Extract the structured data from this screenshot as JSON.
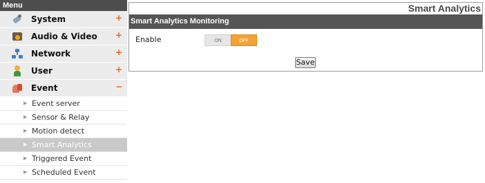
{
  "sidebar": {
    "header": "Menu",
    "items": [
      {
        "label": "System",
        "toggle": "+"
      },
      {
        "label": "Audio & Video",
        "toggle": "+"
      },
      {
        "label": "Network",
        "toggle": "+"
      },
      {
        "label": "User",
        "toggle": "+"
      },
      {
        "label": "Event",
        "toggle": "−"
      }
    ],
    "event_submenu": [
      {
        "label": "Event server"
      },
      {
        "label": "Sensor & Relay"
      },
      {
        "label": "Motion detect"
      },
      {
        "label": "Smart Analytics"
      },
      {
        "label": "Triggered Event"
      },
      {
        "label": "Scheduled Event"
      }
    ],
    "active_submenu": "Smart Analytics"
  },
  "main": {
    "title": "Smart Analytics",
    "section": "Smart Analytics Monitoring",
    "enable": {
      "label": "Enable",
      "on_label": "ON",
      "off_label": "OFF",
      "selected": "OFF"
    },
    "save_label": "Save"
  },
  "colors": {
    "accent": "#f2a333",
    "header_bg": "#555555",
    "toggle_sign": "#e8641e"
  },
  "icons": {
    "system": "gear-icon",
    "audio_video": "camera-icon",
    "network": "network-icon",
    "user": "user-icon",
    "event": "event-icon",
    "submenu_arrow": "triangle-right-icon"
  }
}
